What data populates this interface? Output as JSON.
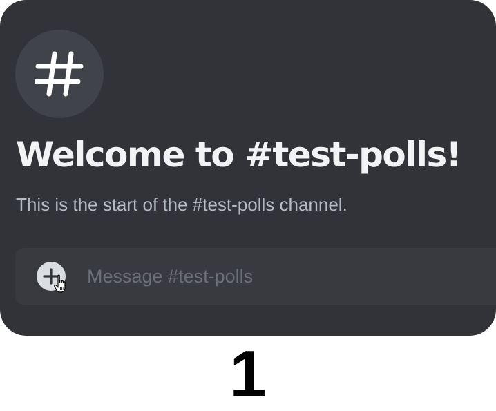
{
  "channel": {
    "icon": "hash-icon",
    "welcome_title": "Welcome to #test-polls!",
    "welcome_subtitle": "This is the start of the #test-polls channel."
  },
  "composer": {
    "attach_icon": "plus-circle-icon",
    "placeholder": "Message #test-polls",
    "value": ""
  },
  "step_label": "1",
  "colors": {
    "panel_background": "#313338",
    "composer_background": "#383a40",
    "icon_circle": "#41434a",
    "title_text": "#f2f3f5",
    "subtitle_text": "#b5bac1",
    "placeholder_text": "#6d6f78"
  }
}
